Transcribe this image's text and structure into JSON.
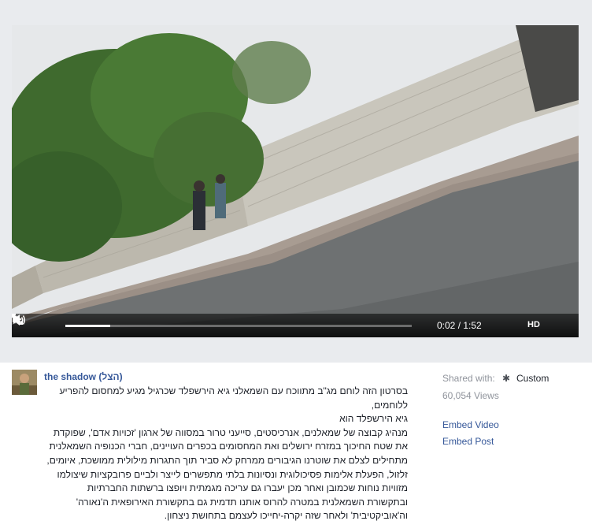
{
  "player": {
    "time_display": "0:02 / 1:52",
    "hd_label": "HD",
    "progress": 0.13
  },
  "post": {
    "author": "the shadow (הצל)",
    "paragraphs": [
      "בסרטון הזה לוחם מג\"ב מתווכח עם השמאלני גיא הירשפלד שכרגיל מגיע למחסום להפריע ללוחמים,",
      "גיא הירשפלד הוא",
      "מנהיג קבוצה של שמאלנים, אנרכיסטים, סייעני טרור במסווה של ארגון 'זכויות אדם', שפוקדת את שטח החיכוך במזרח ירושלים ואת המחסומים בכפרים העויינים, חברי הכנופיה השמאלנית מתחילים לצלם את שוטרנו הגיבורים ממרחק לא סביר תוך התגרות מילולית ממושכת, איומים, זלזול, הפעלת אלימות פסיכולוגית ונסיונות בלתי מתפשרים לייצר ולביים פרובקציות שיצולמו מזוויות נוחות שכמובן ואחר מכן יעברו גם עריכה מגמתית ויופצו ברשתות החברתיות ובתקשורת השמאלנית במטרה להרוס אותנו תדמית גם בתקשורת האירופאית ה'נאורה' וה'אוביקטיבית' ולאחר שזה יקרה-יחייכו לעצמם בתחושת ניצחון."
    ]
  },
  "sidebar": {
    "shared_label": "Shared with:",
    "privacy_value": "Custom",
    "privacy_icon": "gear-icon",
    "views": "60,054 Views",
    "embed_video": "Embed Video",
    "embed_post": "Embed Post"
  }
}
